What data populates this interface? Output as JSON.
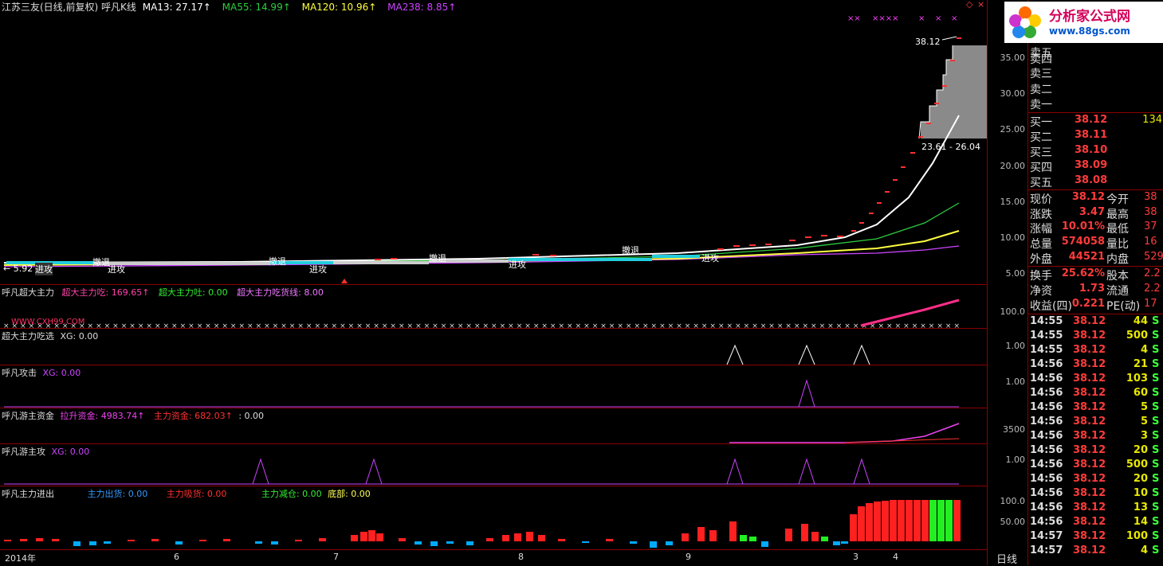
{
  "main_header": {
    "title": "江苏三友(日线,前复权)",
    "indicator": "呼凡K线",
    "ma13": "MA13: 27.17↑",
    "ma55": "MA55: 14.99↑",
    "ma120": "MA120: 10.96↑",
    "ma238": "MA238: 8.85↑",
    "diamond": "◇"
  },
  "annotations": {
    "high_price": "38.12",
    "range": "23.61 - 26.04",
    "low_price": "← 5.92",
    "signals": [
      "进攻",
      "撤退",
      "进攻",
      "撤退",
      "进攻",
      "撤退",
      "进攻",
      "撤退",
      "进攻"
    ]
  },
  "price_axis": [
    "35.00",
    "30.00",
    "25.00",
    "20.00",
    "15.00",
    "10.00",
    "5.00"
  ],
  "panels": {
    "p1": {
      "title": "呼凡超大主力",
      "a": "超大主力吃: 169.65↑",
      "b": "超大主力吐: 0.00",
      "c": "超大主力吃货线: 8.00",
      "watermark": "WWW.CXH99.COM",
      "tick": "100.0"
    },
    "p2": {
      "title": "超大主力吃选",
      "a": "XG: 0.00",
      "tick": "1.00"
    },
    "p3": {
      "title": "呼凡攻击",
      "a": "XG: 0.00",
      "tick": "1.00"
    },
    "p4": {
      "title": "呼凡游主资金",
      "a": "拉升资金: 4983.74↑",
      "b": "主力资金: 682.03↑",
      "c": ": 0.00",
      "tick": "3500"
    },
    "p5": {
      "title": "呼凡游主攻",
      "a": "XG: 0.00",
      "tick": "1.00"
    },
    "p6": {
      "title": "呼凡主力进出",
      "a": "主力出货: 0.00",
      "b": "主力吸货: 0.00",
      "c": "主力减仓: 0.00",
      "d": "底部: 0.00",
      "tick1": "100.0",
      "tick2": "50.00"
    }
  },
  "x_axis": {
    "year": "2014年",
    "months": [
      "6",
      "7",
      "8",
      "9",
      "3",
      "4"
    ],
    "period": "日线"
  },
  "logo": {
    "brand": "分析家公式网",
    "url": "www.88gs.com"
  },
  "order_book": {
    "sell": [
      {
        "label": "卖五"
      },
      {
        "label": "卖四"
      },
      {
        "label": "卖三"
      },
      {
        "label": "卖二"
      },
      {
        "label": "卖一"
      }
    ],
    "buy": [
      {
        "label": "买一",
        "price": "38.12",
        "vol": "134"
      },
      {
        "label": "买二",
        "price": "38.11",
        "vol": ""
      },
      {
        "label": "买三",
        "price": "38.10",
        "vol": ""
      },
      {
        "label": "买四",
        "price": "38.09",
        "vol": ""
      },
      {
        "label": "买五",
        "price": "38.08",
        "vol": ""
      }
    ]
  },
  "quote": [
    {
      "k": "现价",
      "v": "38.12",
      "k2": "今开",
      "v2": "38"
    },
    {
      "k": "涨跌",
      "v": "3.47",
      "k2": "最高",
      "v2": "38"
    },
    {
      "k": "涨幅",
      "v": "10.01%",
      "k2": "最低",
      "v2": "37"
    },
    {
      "k": "总量",
      "v": "574058",
      "k2": "量比",
      "v2": "16"
    },
    {
      "k": "外盘",
      "v": "44521",
      "k2": "内盘",
      "v2": "529"
    },
    {
      "k": "换手",
      "v": "25.62%",
      "k2": "股本",
      "v2": "2.2"
    },
    {
      "k": "净资",
      "v": "1.73",
      "k2": "流通",
      "v2": "2.2"
    },
    {
      "k": "收益(四)",
      "v": "0.221",
      "k2": "PE(动)",
      "v2": "17"
    }
  ],
  "ticks": [
    {
      "t": "14:55",
      "p": "38.12",
      "v": "44",
      "s": "S"
    },
    {
      "t": "14:55",
      "p": "38.12",
      "v": "500",
      "s": "S"
    },
    {
      "t": "14:55",
      "p": "38.12",
      "v": "4",
      "s": "S"
    },
    {
      "t": "14:56",
      "p": "38.12",
      "v": "21",
      "s": "S"
    },
    {
      "t": "14:56",
      "p": "38.12",
      "v": "103",
      "s": "S"
    },
    {
      "t": "14:56",
      "p": "38.12",
      "v": "60",
      "s": "S"
    },
    {
      "t": "14:56",
      "p": "38.12",
      "v": "5",
      "s": "S"
    },
    {
      "t": "14:56",
      "p": "38.12",
      "v": "5",
      "s": "S"
    },
    {
      "t": "14:56",
      "p": "38.12",
      "v": "3",
      "s": "S"
    },
    {
      "t": "14:56",
      "p": "38.12",
      "v": "20",
      "s": "S"
    },
    {
      "t": "14:56",
      "p": "38.12",
      "v": "500",
      "s": "S"
    },
    {
      "t": "14:56",
      "p": "38.12",
      "v": "20",
      "s": "S"
    },
    {
      "t": "14:56",
      "p": "38.12",
      "v": "10",
      "s": "S"
    },
    {
      "t": "14:56",
      "p": "38.12",
      "v": "13",
      "s": "S"
    },
    {
      "t": "14:56",
      "p": "38.12",
      "v": "14",
      "s": "S"
    },
    {
      "t": "14:57",
      "p": "38.12",
      "v": "100",
      "s": "S"
    },
    {
      "t": "14:57",
      "p": "38.12",
      "v": "4",
      "s": "S"
    }
  ],
  "colors": {
    "ma13": "#ffffff",
    "ma55": "#2ecc40",
    "ma120": "#ffff40",
    "ma238": "#cc44ff",
    "up": "#ff2020",
    "down": "#00c8ff",
    "green": "#22ee22"
  }
}
